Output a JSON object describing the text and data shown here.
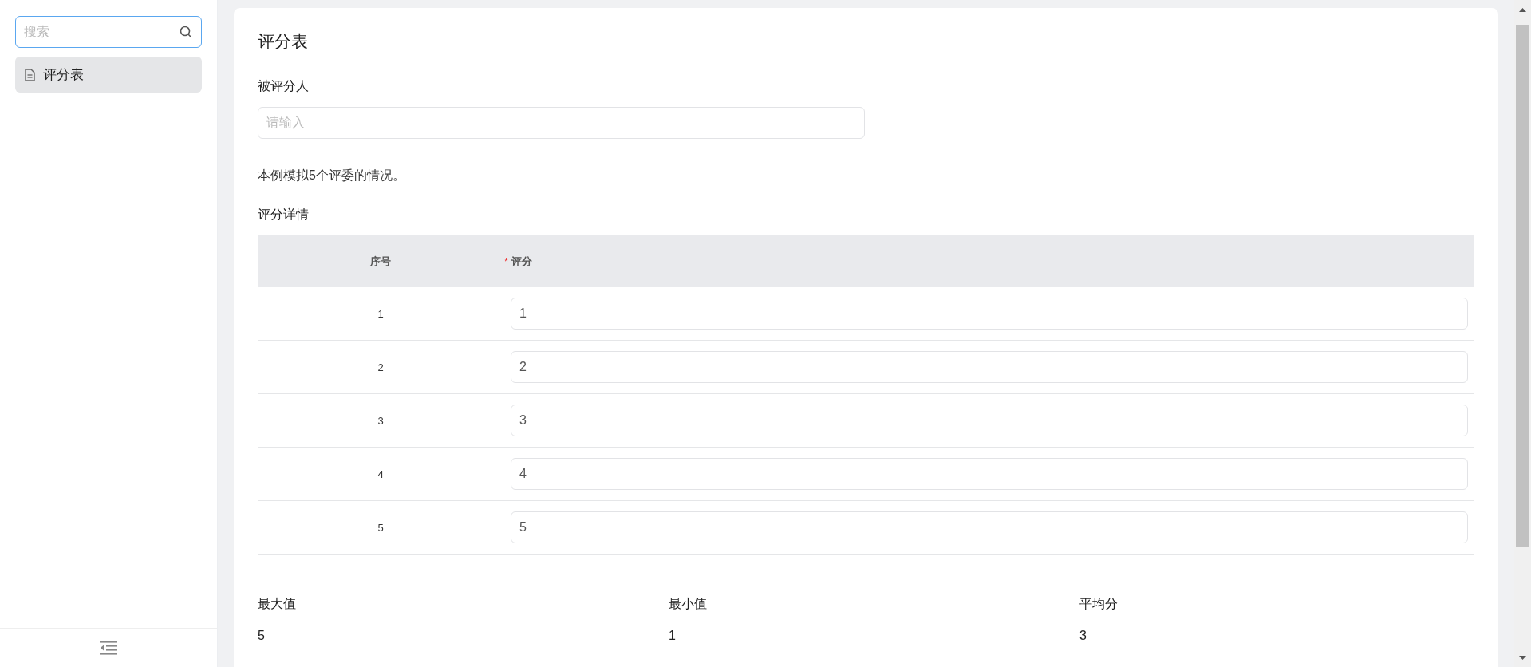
{
  "sidebar": {
    "search": {
      "placeholder": "搜索"
    },
    "items": [
      {
        "label": "评分表",
        "selected": true
      }
    ]
  },
  "form": {
    "title": "评分表",
    "field": {
      "label": "被评分人",
      "placeholder": "请输入"
    },
    "note": "本例模拟5个评委的情况。",
    "section": "评分详情",
    "table": {
      "columns": [
        {
          "label": "序号"
        },
        {
          "label": "评分",
          "required_mark": "*"
        }
      ],
      "rows": [
        {
          "index": "1",
          "score": "1"
        },
        {
          "index": "2",
          "score": "2"
        },
        {
          "index": "3",
          "score": "3"
        },
        {
          "index": "4",
          "score": "4"
        },
        {
          "index": "5",
          "score": "5"
        }
      ]
    },
    "stats": [
      {
        "label": "最大值",
        "value": "5"
      },
      {
        "label": "最小值",
        "value": "1"
      },
      {
        "label": "平均分",
        "value": "3"
      }
    ]
  }
}
